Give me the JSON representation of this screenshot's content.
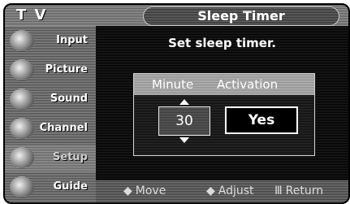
{
  "header": {
    "tv_label": "T V",
    "title": "Sleep Timer"
  },
  "sidebar": {
    "items": [
      {
        "label": "Input"
      },
      {
        "label": "Picture"
      },
      {
        "label": "Sound"
      },
      {
        "label": "Channel"
      },
      {
        "label": "Setup"
      },
      {
        "label": "Guide"
      }
    ]
  },
  "main": {
    "subtitle": "Set sleep timer.",
    "columns": {
      "minute": "Minute",
      "activation": "Activation"
    },
    "minute_value": "30",
    "activation_value": "Yes"
  },
  "footer": {
    "move": {
      "glyph": "◆",
      "label": "Move"
    },
    "adjust": {
      "glyph": "◆",
      "label": "Adjust"
    },
    "return": {
      "glyph": "Ⅲ",
      "label": "Return"
    }
  }
}
